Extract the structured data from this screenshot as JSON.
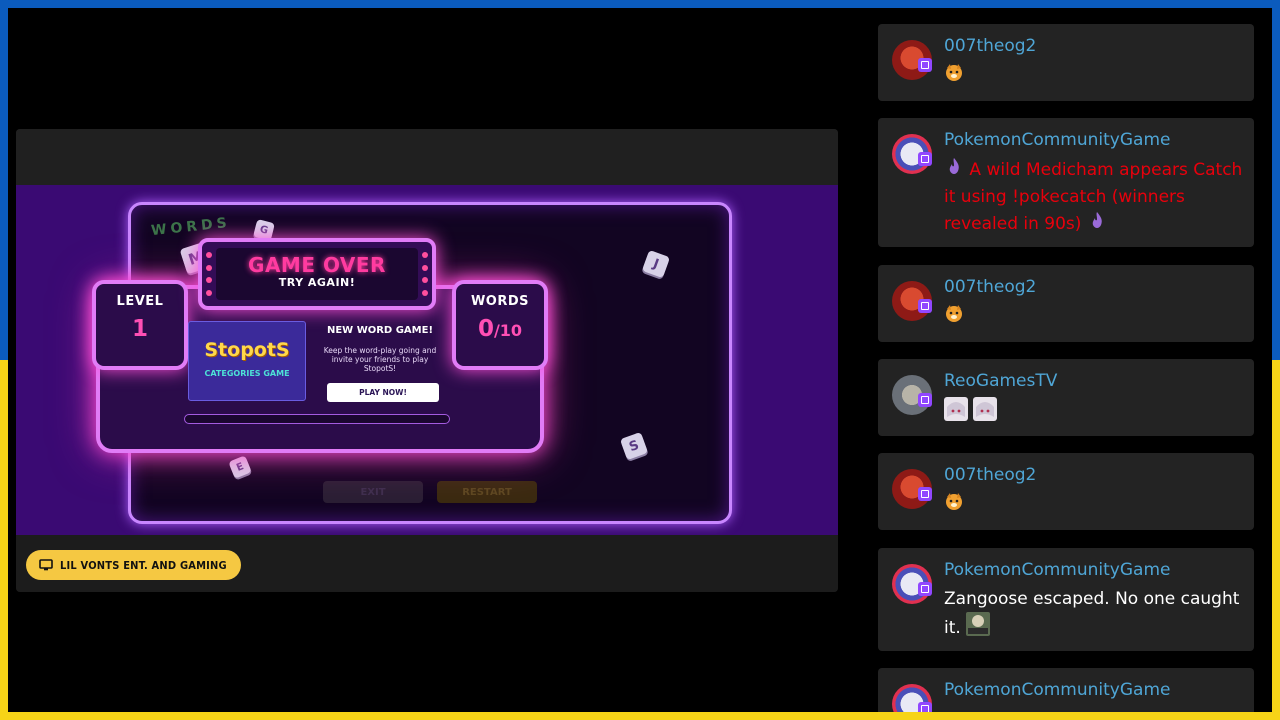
{
  "channel": {
    "name": "LIL VONTS ENT. AND GAMING"
  },
  "game": {
    "title": "GAME OVER",
    "subtitle": "TRY AGAIN!",
    "level_label": "LEVEL",
    "level_value": "1",
    "words_label": "WORDS",
    "words_value": "0",
    "words_total": "/10",
    "ad_logo": "StopotS",
    "ad_category": "CATEGORIES GAME",
    "ad_heading": "NEW WORD GAME!",
    "ad_description": "Keep the word-play going and invite your friends to play StopotS!",
    "play_button": "PLAY NOW!",
    "exit_button": "EXIT",
    "restart_button": "RESTART",
    "bg_logo": "WORDS",
    "dice": [
      "M",
      "G",
      "J",
      "E",
      "S"
    ]
  },
  "chat": {
    "messages": [
      {
        "username": "007theog2",
        "text": "",
        "emotes": [
          "dog-emote"
        ],
        "style": "normal"
      },
      {
        "username": "PokemonCommunityGame",
        "text": "A wild Medicham appears Catch it using !pokecatch (winners revealed in 90s)",
        "emotes": [
          "flame-emote",
          "flame-emote"
        ],
        "style": "red"
      },
      {
        "username": "007theog2",
        "text": "",
        "emotes": [
          "dog-emote"
        ],
        "style": "normal"
      },
      {
        "username": "ReoGamesTV",
        "text": "",
        "emotes": [
          "anime-emote",
          "anime-emote"
        ],
        "style": "normal"
      },
      {
        "username": "007theog2",
        "text": "",
        "emotes": [
          "dog-emote"
        ],
        "style": "normal"
      },
      {
        "username": "PokemonCommunityGame",
        "text": "Zangoose escaped. No one caught it.",
        "emotes": [
          "rigged-emote"
        ],
        "style": "normal"
      },
      {
        "username": "PokemonCommunityGame",
        "text": "",
        "emotes": [],
        "style": "red"
      }
    ]
  },
  "colors": {
    "flag_blue": "#0b5bbd",
    "flag_yellow": "#f7d417",
    "username": "#4fa6d6",
    "alert_red": "#e8000c",
    "pill_yellow": "#f5c842",
    "neon_pink": "#ff3ba0"
  }
}
